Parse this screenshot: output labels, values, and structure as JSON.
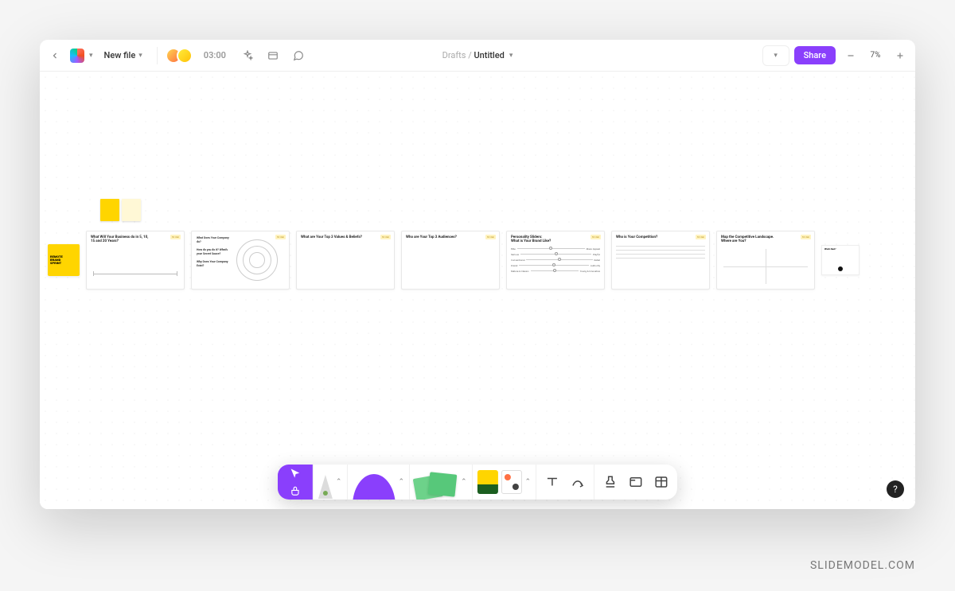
{
  "header": {
    "new_file_label": "New file",
    "timer_value": "03:00",
    "breadcrumb_parent": "Drafts",
    "breadcrumb_sep": "/",
    "breadcrumb_current": "Untitled",
    "share_label": "Share",
    "zoom_label": "7%"
  },
  "frames": {
    "cover": {
      "line1": "REMOTE",
      "line2": "BRAND",
      "line3": "SPRINT"
    },
    "f1": {
      "title": "What Will Your Business do in 5, 10, 15 and 20 Years?"
    },
    "f2": {
      "q1": "What Does Your Company do?",
      "q2": "How do you do it? What's your Secret Sauce?",
      "q3": "Why Does Your Company Exist?"
    },
    "f3": {
      "title": "What are Your Top 3 Values & Beliefs?"
    },
    "f4": {
      "title": "Who are Your Top 3 Audiences?"
    },
    "f5": {
      "title_a": "Personality Sliders:",
      "title_b": "What is Your Brand Like?",
      "rows": [
        {
          "left": "Elite",
          "right": "Mass Appeal"
        },
        {
          "left": "Serious",
          "right": "Playful"
        },
        {
          "left": "Conventional",
          "right": "Rebel"
        },
        {
          "left": "Friend",
          "right": "Authority"
        },
        {
          "left": "Mature & Classic",
          "right": "Young & Innovative"
        }
      ]
    },
    "f6": {
      "title": "Who is Your Competition?"
    },
    "f7": {
      "title": "Map the Competitive Landscape. Where are You?"
    },
    "trail": {
      "title": "What's Next?"
    }
  },
  "badge_text": "10 min",
  "help_label": "?",
  "watermark": "SLIDEMODEL.COM"
}
